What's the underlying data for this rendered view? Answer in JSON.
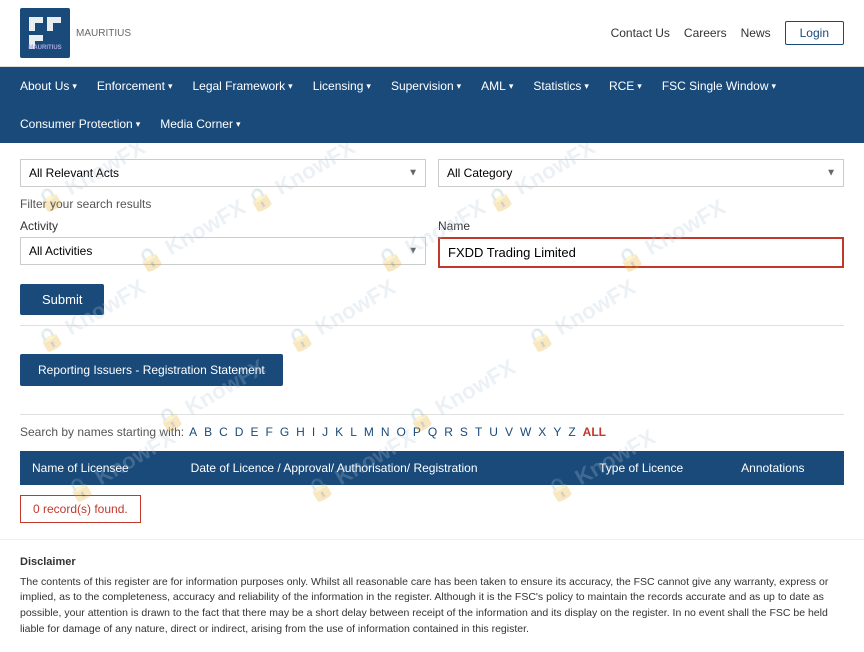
{
  "topBar": {
    "logoText": "FSC",
    "logoSubText": "MAURITIUS",
    "links": {
      "contact": "Contact Us",
      "careers": "Careers",
      "news": "News",
      "login": "Login"
    }
  },
  "nav": {
    "items": [
      {
        "label": "About Us",
        "hasDropdown": true
      },
      {
        "label": "Enforcement",
        "hasDropdown": true
      },
      {
        "label": "Legal Framework",
        "hasDropdown": true
      },
      {
        "label": "Licensing",
        "hasDropdown": true
      },
      {
        "label": "Supervision",
        "hasDropdown": true
      },
      {
        "label": "AML",
        "hasDropdown": true
      },
      {
        "label": "Statistics",
        "hasDropdown": true
      },
      {
        "label": "RCE",
        "hasDropdown": true
      },
      {
        "label": "FSC Single Window",
        "hasDropdown": true
      },
      {
        "label": "Consumer Protection",
        "hasDropdown": true
      },
      {
        "label": "Media Corner",
        "hasDropdown": true
      }
    ]
  },
  "filters": {
    "relevantActs": {
      "label": "All Relevant Acts",
      "options": [
        "All Relevant Acts"
      ]
    },
    "category": {
      "label": "All Category",
      "options": [
        "All Category"
      ]
    },
    "filterLabel": "Filter your search results",
    "activity": {
      "label": "Activity",
      "options": [
        "All Activities"
      ]
    },
    "name": {
      "label": "Name",
      "value": "FXDD Trading Limited",
      "placeholder": "FXDD Trading Limited"
    },
    "submitLabel": "Submit"
  },
  "registrationBtn": {
    "label": "Reporting Issuers - Registration Statement"
  },
  "alphabetSearch": {
    "label": "Search by names starting with:",
    "letters": [
      "A",
      "B",
      "C",
      "D",
      "E",
      "F",
      "G",
      "H",
      "I",
      "J",
      "K",
      "L",
      "M",
      "N",
      "O",
      "P",
      "Q",
      "R",
      "S",
      "T",
      "U",
      "V",
      "W",
      "X",
      "Y",
      "Z"
    ],
    "allLabel": "ALL"
  },
  "table": {
    "headers": [
      "Name of Licensee",
      "Date of Licence / Approval/ Authorisation/ Registration",
      "Type of Licence",
      "Annotations"
    ],
    "noRecordsMessage": "0 record(s) found."
  },
  "disclaimer": {
    "title": "Disclaimer",
    "text": "The contents of this register are for information purposes only. Whilst all reasonable care has been taken to ensure its accuracy, the FSC cannot give any warranty, express or implied, as to the completeness, accuracy and reliability of the information in the register. Although it is the FSC's policy to maintain the records accurate and as up to date as possible, your attention is drawn to the fact that there may be a short delay between receipt of the information and its display on the register. In no event shall the FSC be held liable for damage of any nature, direct or indirect, arising from the use of information contained in this register."
  },
  "watermark": {
    "text": "KnowFX"
  }
}
